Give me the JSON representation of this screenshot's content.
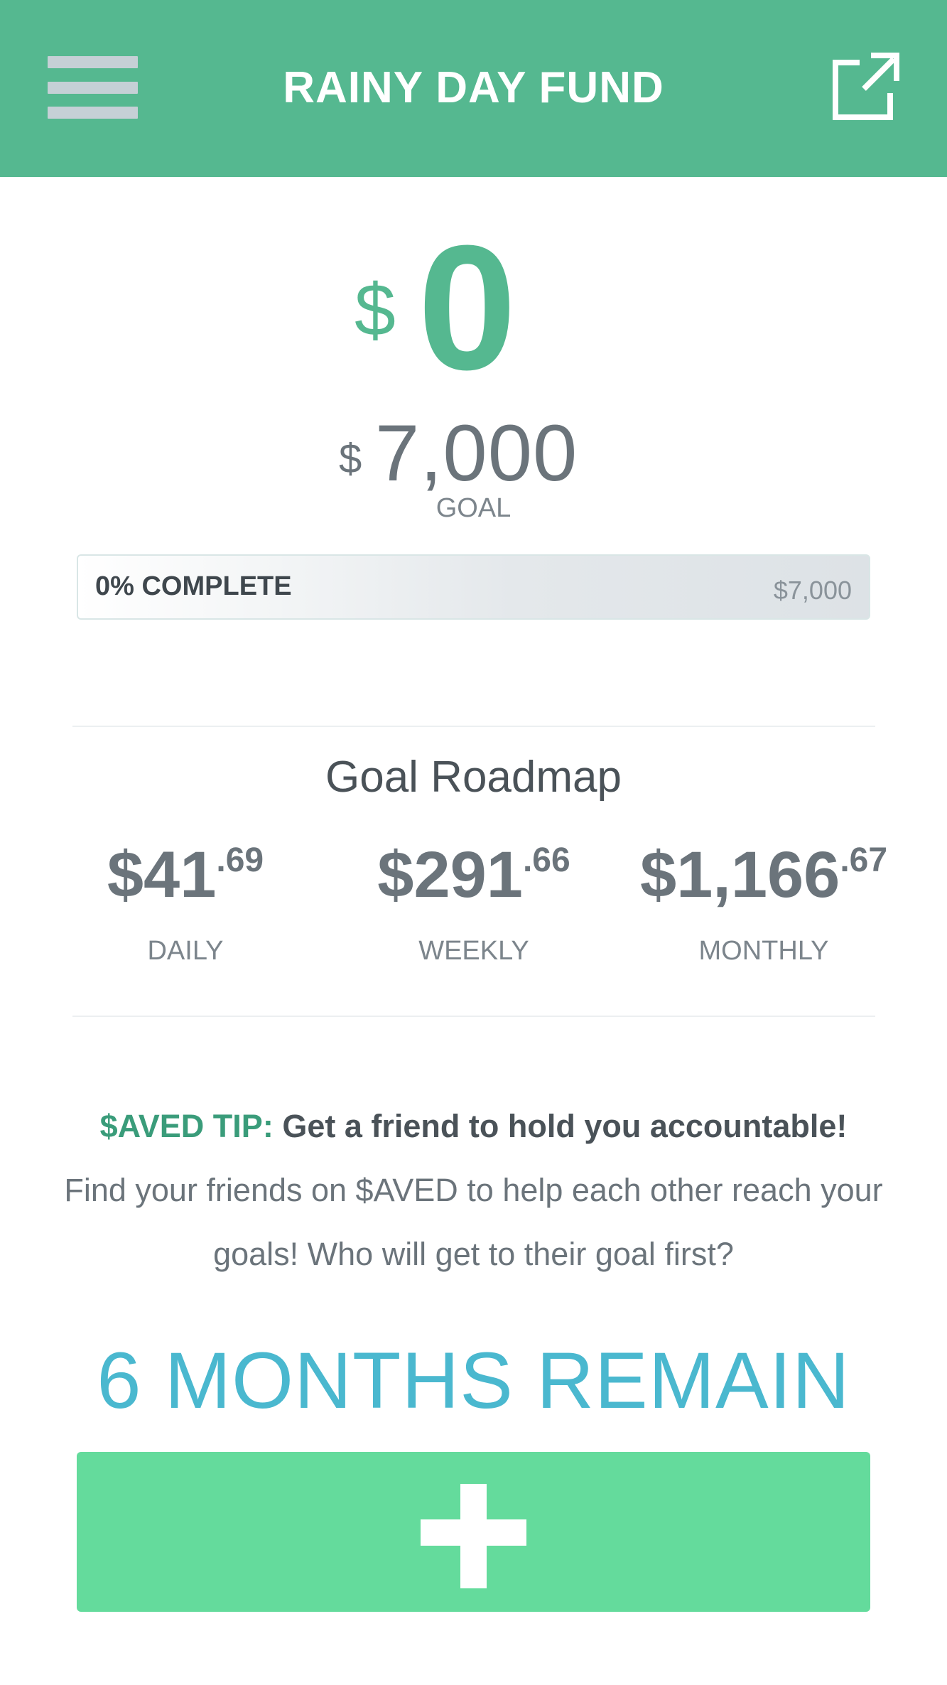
{
  "header": {
    "title": "RAINY DAY FUND"
  },
  "saved": {
    "currency_symbol": "$",
    "amount": "0"
  },
  "goal": {
    "currency_symbol": "$",
    "amount": "7,000",
    "label": "GOAL"
  },
  "progress": {
    "label": "0% COMPLETE",
    "target": "$7,000",
    "fraction": 0
  },
  "roadmap": {
    "title": "Goal Roadmap",
    "items": [
      {
        "dollars": "$41",
        "cents": ".69",
        "label": "DAILY"
      },
      {
        "dollars": "$291",
        "cents": ".66",
        "label": "WEEKLY"
      },
      {
        "dollars": "$1,166",
        "cents": ".67",
        "label": "MONTHLY"
      }
    ]
  },
  "tip": {
    "prefix": "$AVED TIP:",
    "headline": "Get a friend to hold you accountable!",
    "body": "Find your friends on $AVED to help each other reach your goals! Who will get to their goal first?"
  },
  "remaining": "6 MONTHS REMAIN",
  "icons": {
    "menu": "menu-icon",
    "share": "share-icon",
    "add": "plus-icon"
  },
  "colors": {
    "brand_green": "#55b890",
    "button_green": "#64db9c",
    "remain_blue": "#4ab8cf"
  }
}
